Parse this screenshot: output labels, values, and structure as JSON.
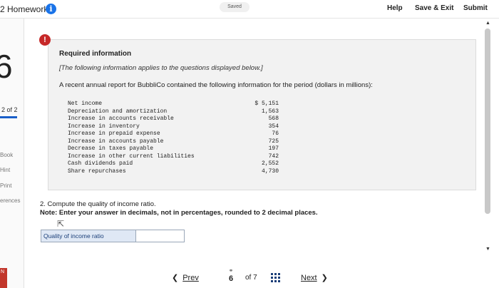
{
  "header": {
    "title": "2 Homework",
    "saved_label": "Saved",
    "help_label": "Help",
    "save_exit_label": "Save & Exit",
    "submit_label": "Submit"
  },
  "sidebar": {
    "big_number": "6",
    "progress_label": "2 of 2",
    "links": [
      "Book",
      "Hint",
      "Print",
      "erences"
    ]
  },
  "question": {
    "alert_symbol": "!",
    "heading": "Required information",
    "note": "[The following information applies to the questions displayed below.]",
    "intro": "A recent annual report for BubbliCo contained the following information for the period (dollars in millions):",
    "items": [
      {
        "label": "Net income",
        "value": "$ 5,151"
      },
      {
        "label": "Depreciation and amortization",
        "value": "1,563"
      },
      {
        "label": "Increase in accounts receivable",
        "value": "568"
      },
      {
        "label": "Increase in inventory",
        "value": "354"
      },
      {
        "label": "Increase in prepaid expense",
        "value": "76"
      },
      {
        "label": "Increase in accounts payable",
        "value": "725"
      },
      {
        "label": "Decrease in taxes payable",
        "value": "197"
      },
      {
        "label": "Increase in other current liabilities",
        "value": "742"
      },
      {
        "label": "Cash dividends paid",
        "value": "2,552"
      },
      {
        "label": "Share repurchases",
        "value": "4,730"
      }
    ],
    "prompt": "2. Compute the quality of income ratio.",
    "instruction": "Note: Enter your answer in decimals, not in percentages, rounded to 2 decimal places.",
    "answer_label": "Quality of income ratio",
    "answer_value": ""
  },
  "nav": {
    "prev_label": "Prev",
    "current_page": "6",
    "of_total": "of 7",
    "next_label": "Next"
  },
  "colors": {
    "accent": "#1a73e8",
    "alert": "#c62828",
    "answer_label_bg": "#dfe8f5"
  }
}
